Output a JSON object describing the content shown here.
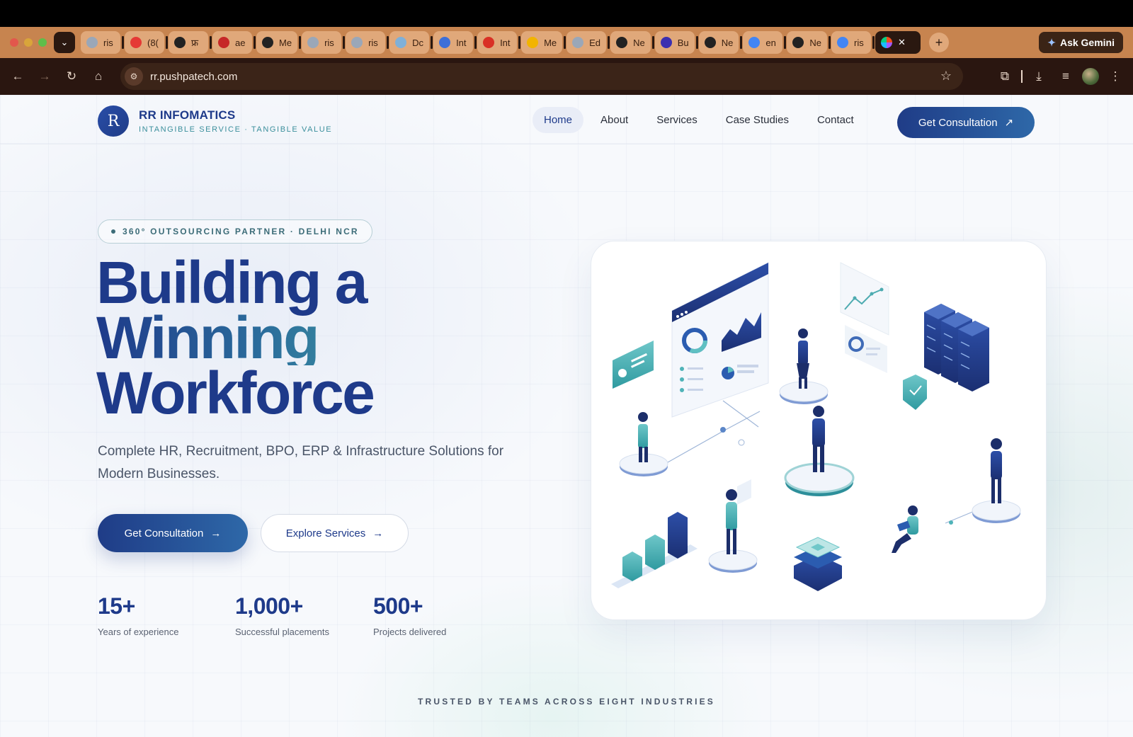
{
  "browser": {
    "tabs": [
      {
        "label": "ris",
        "icon": "globe-icon",
        "color": "#9aa7b8"
      },
      {
        "label": "(8(",
        "icon": "youtube-icon",
        "color": "#e53935"
      },
      {
        "label": "फ्र",
        "icon": "megaphone-icon",
        "color": "#222222"
      },
      {
        "label": "ae",
        "icon": "pdf-icon",
        "color": "#c62828"
      },
      {
        "label": "Me",
        "icon": "openai-icon",
        "color": "#222222"
      },
      {
        "label": "ris",
        "icon": "globe-icon",
        "color": "#9aa7b8"
      },
      {
        "label": "ris",
        "icon": "globe-icon",
        "color": "#9aa7b8"
      },
      {
        "label": "Dc",
        "icon": "docs-icon",
        "color": "#7fb0d8"
      },
      {
        "label": "Int",
        "icon": "mail-icon",
        "color": "#3d6fd8"
      },
      {
        "label": "Int",
        "icon": "gmail-icon",
        "color": "#d93025"
      },
      {
        "label": "Me",
        "icon": "meet-icon",
        "color": "#f2b400"
      },
      {
        "label": "Ed",
        "icon": "globe-icon",
        "color": "#9aa7b8"
      },
      {
        "label": "Ne",
        "icon": "openai-icon",
        "color": "#222222"
      },
      {
        "label": "Bu",
        "icon": "d-icon",
        "color": "#3b2fb0"
      },
      {
        "label": "Ne",
        "icon": "openai-icon",
        "color": "#222222"
      },
      {
        "label": "en",
        "icon": "google-icon",
        "color": "#4285f4"
      },
      {
        "label": "Ne",
        "icon": "openai-icon",
        "color": "#222222"
      },
      {
        "label": "ris",
        "icon": "google-icon",
        "color": "#4285f4"
      }
    ],
    "active_tab_icon": "figma-icon",
    "gemini_label": "Ask Gemini",
    "url": "rr.pushpatech.com"
  },
  "site": {
    "brand_name": "RR INFOMATICS",
    "brand_tagline": "INTANGIBLE SERVICE · TANGIBLE VALUE",
    "logo_letter": "R",
    "nav": [
      {
        "label": "Home",
        "active": true
      },
      {
        "label": "About",
        "active": false
      },
      {
        "label": "Services",
        "active": false
      },
      {
        "label": "Case Studies",
        "active": false
      },
      {
        "label": "Contact",
        "active": false
      }
    ],
    "cta_top": "Get Consultation",
    "badge": "360° OUTSOURCING PARTNER · DELHI NCR",
    "headline": {
      "line1": "Building a",
      "line2": "Winning",
      "line3": "Workforce"
    },
    "subtext": "Complete HR, Recruitment, BPO, ERP & Infrastructure Solutions for Modern Businesses.",
    "btn_primary": "Get Consultation",
    "btn_secondary": "Explore Services",
    "stats": [
      {
        "value": "15+",
        "label": "Years of experience"
      },
      {
        "value": "1,000+",
        "label": "Successful placements"
      },
      {
        "value": "500+",
        "label": "Projects delivered"
      }
    ],
    "trusted": "TRUSTED BY TEAMS ACROSS EIGHT INDUSTRIES"
  },
  "colors": {
    "primary": "#1e3a8a",
    "teal": "#3a8f9f",
    "tab_strip": "#c7844f",
    "toolbar": "#2a1610"
  }
}
